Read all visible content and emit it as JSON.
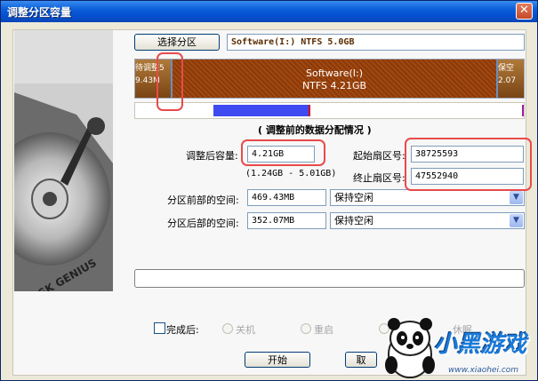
{
  "window": {
    "title": "调整分区容量",
    "close": "✕"
  },
  "top": {
    "select_button": "选择分区",
    "partition_info": "Software(I:) NTFS 5.0GB"
  },
  "diskbar": {
    "left_label_1": "待调整5",
    "left_label_2": "9.43M",
    "center_label_1": "Software(I:)",
    "center_label_2": "NTFS 4.21GB",
    "right_label_1": "保空",
    "right_label_2": "2.07"
  },
  "section": {
    "heading": "( 调整前的数据分配情况 )"
  },
  "size": {
    "label": "调整后容量:",
    "value": "4.21GB",
    "range": "(1.24GB - 5.01GB)"
  },
  "sectors": {
    "start_label": "起始扇区号:",
    "start_value": "38725593",
    "end_label": "终止扇区号:",
    "end_value": "47552940"
  },
  "before": {
    "label": "分区前部的空间:",
    "value": "469.43MB",
    "option": "保持空闲"
  },
  "after": {
    "label": "分区后部的空间:",
    "value": "352.07MB",
    "option": "保持空闲"
  },
  "finish": {
    "label": "完成后:",
    "options": [
      "关机",
      "重启",
      "休眠"
    ]
  },
  "buttons": {
    "start": "开始",
    "cancel": "取"
  },
  "watermark": {
    "brand": "小黑游戏",
    "url": "www.xiaohei.com"
  },
  "art": {
    "logo": "DISK GENIUS"
  }
}
